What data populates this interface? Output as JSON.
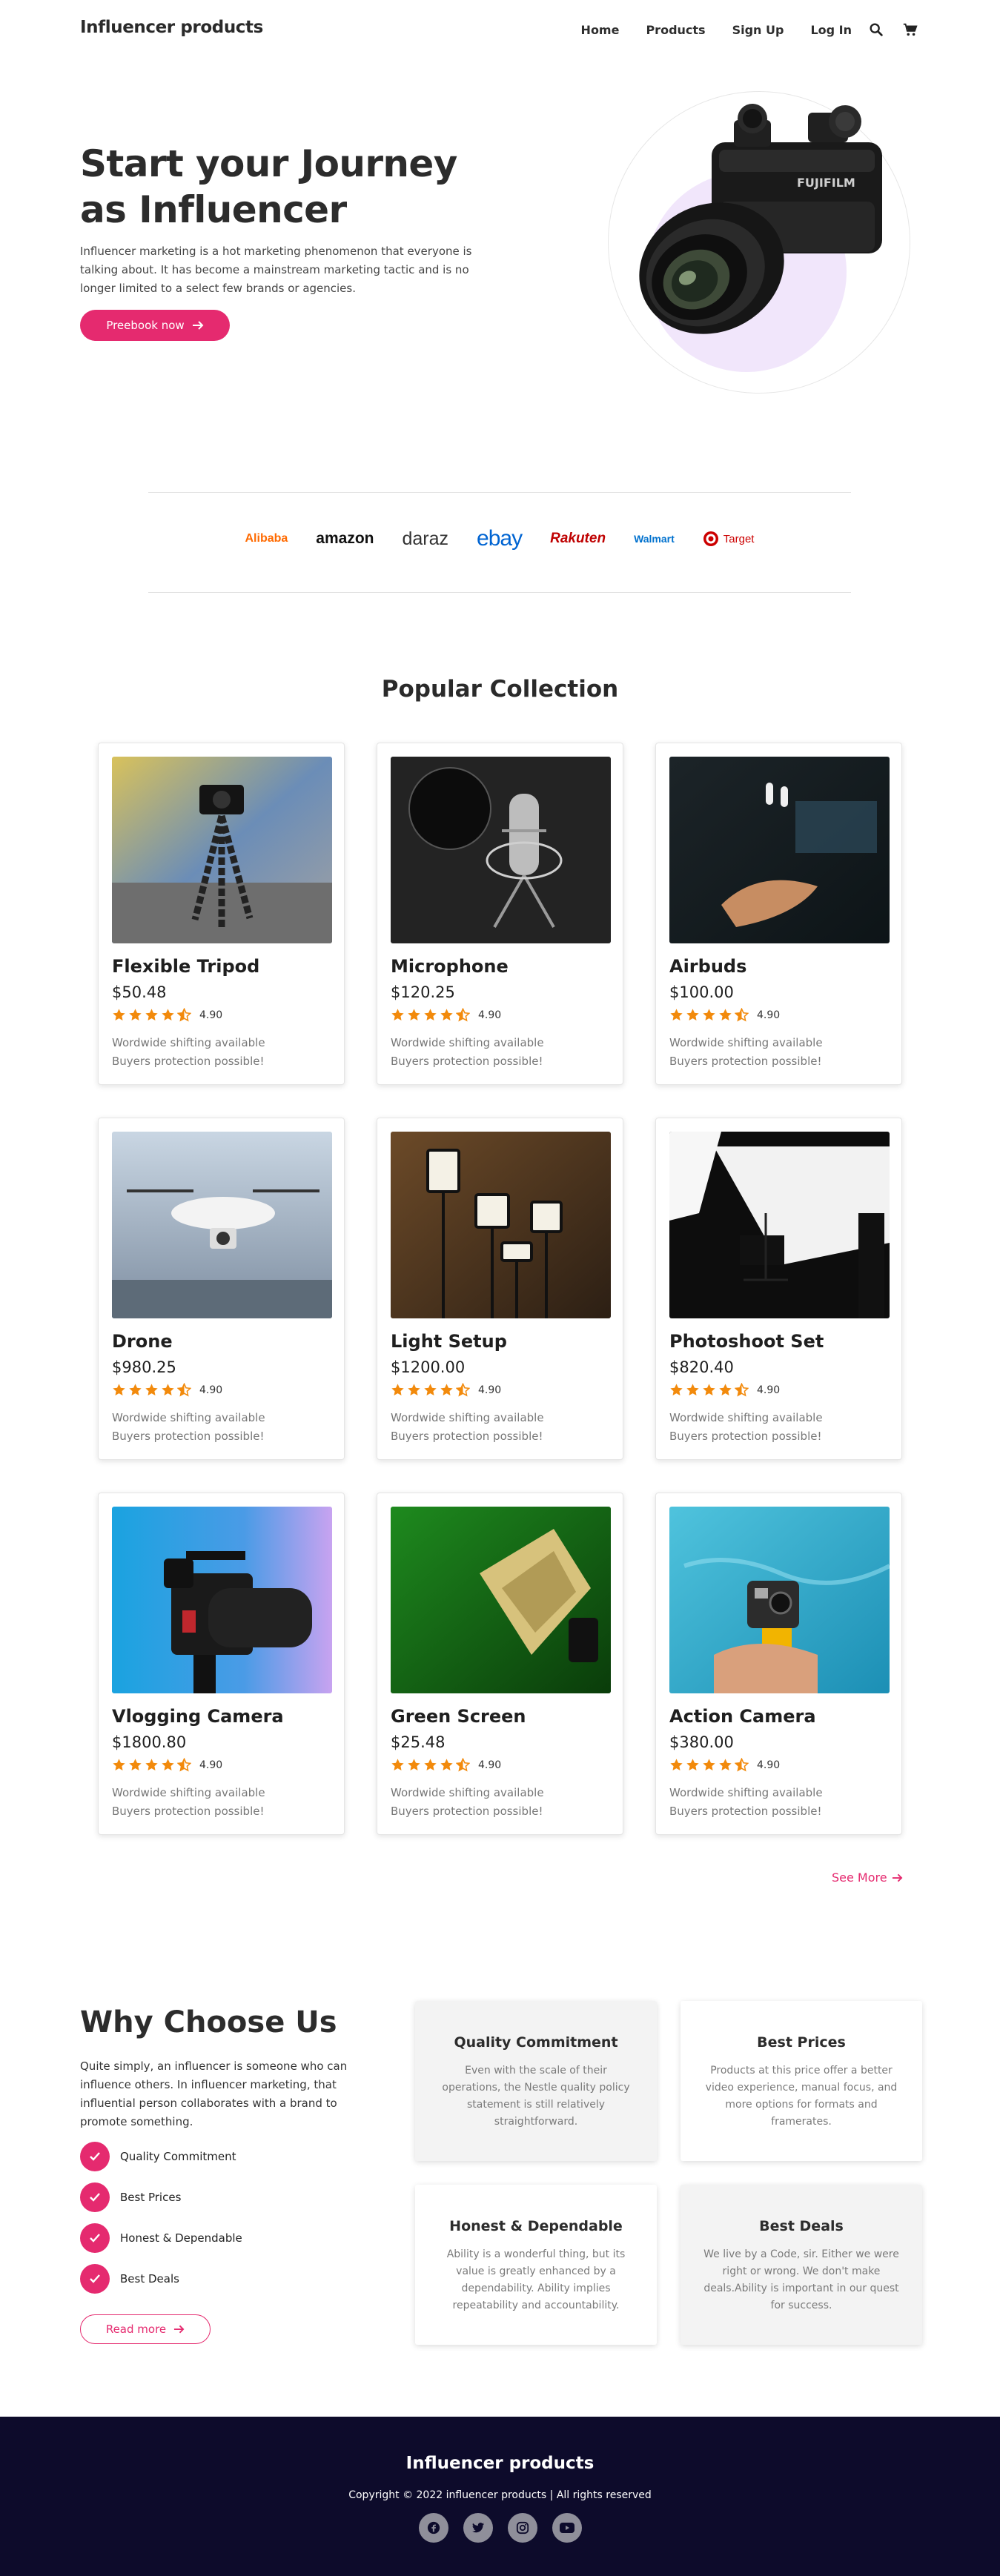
{
  "nav": {
    "brand": "Influencer products",
    "links": [
      "Home",
      "Products",
      "Sign Up",
      "Log In"
    ],
    "search_icon": "search-icon",
    "cart_icon": "cart-icon"
  },
  "hero": {
    "title_line1": "Start your Journey",
    "title_line2": "as Influencer",
    "text": "Influencer marketing is a hot marketing phenomenon that everyone is talking about. It has become a mainstream marketing tactic and is no longer limited to a select few brands or agencies.",
    "cta": "Preebook now"
  },
  "brands": [
    "Alibaba",
    "amazon",
    "daraz",
    "ebay",
    "Rakuten",
    "Walmart",
    "Target"
  ],
  "collection": {
    "title": "Popular Collection",
    "ship_line1": "Wordwide shifting available",
    "ship_line2": "Buyers protection possible!",
    "products": [
      {
        "name": "Flexible Tripod",
        "price": "$50.48",
        "rating": "4.90"
      },
      {
        "name": "Microphone",
        "price": "$120.25",
        "rating": "4.90"
      },
      {
        "name": "Airbuds",
        "price": "$100.00",
        "rating": "4.90"
      },
      {
        "name": "Drone",
        "price": "$980.25",
        "rating": "4.90"
      },
      {
        "name": "Light Setup",
        "price": "$1200.00",
        "rating": "4.90"
      },
      {
        "name": "Photoshoot Set",
        "price": "$820.40",
        "rating": "4.90"
      },
      {
        "name": "Vlogging Camera",
        "price": "$1800.80",
        "rating": "4.90"
      },
      {
        "name": "Green Screen",
        "price": "$25.48",
        "rating": "4.90"
      },
      {
        "name": "Action Camera",
        "price": "$380.00",
        "rating": "4.90"
      }
    ],
    "see_more": "See More"
  },
  "why": {
    "title": "Why Choose Us",
    "text": "Quite simply, an influencer is someone who can influence others. In influencer marketing, that influential person collaborates with a brand to promote something.",
    "items": [
      "Quality Commitment",
      "Best Prices",
      "Honest & Dependable",
      "Best Deals"
    ],
    "cta": "Read more",
    "features": [
      {
        "title": "Quality Commitment",
        "text": "Even with the scale of their operations, the Nestle quality policy statement is still relatively straightforward."
      },
      {
        "title": "Best Prices",
        "text": "Products at this price offer a better video experience, manual focus, and more options for formats and framerates."
      },
      {
        "title": "Honest & Dependable",
        "text": "Ability is a wonderful thing, but its value is greatly enhanced by a dependability. Ability implies repeatability and accountability."
      },
      {
        "title": "Best Deals",
        "text": "We live by a Code, sir. Either we were right or wrong. We don't make deals.Ability is important in our quest for success."
      }
    ]
  },
  "footer": {
    "brand": "Influencer products",
    "copyright": "Copyright © 2022 influencer products | All rights reserved",
    "socials": [
      "facebook-icon",
      "twitter-icon",
      "instagram-icon",
      "youtube-icon"
    ]
  },
  "colors": {
    "accent": "#e52a6f",
    "footer_bg": "#0d0b2b",
    "star": "#f28a0c"
  }
}
